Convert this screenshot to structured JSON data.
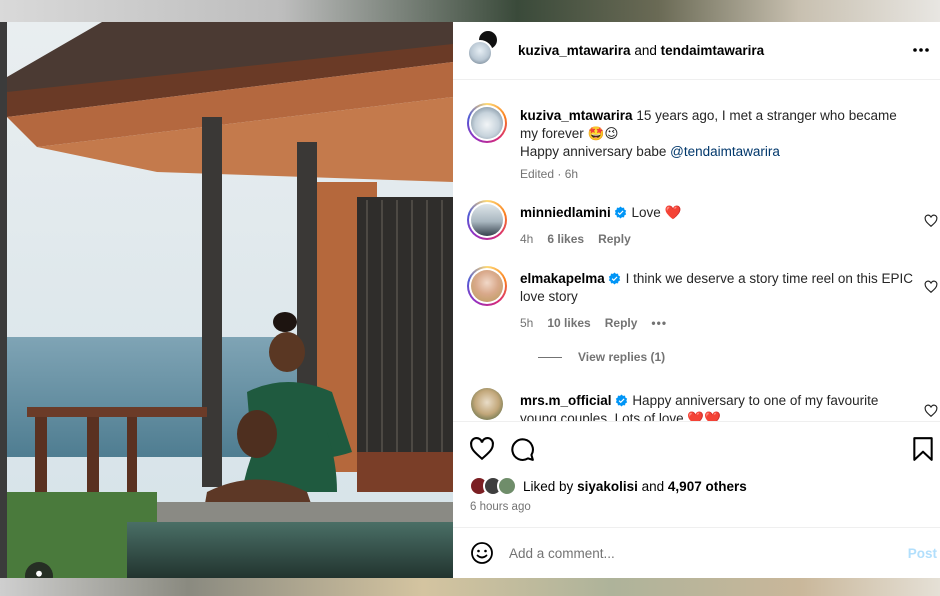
{
  "header": {
    "user1": "kuziva_mtawarira",
    "conjunction": "and",
    "user2": "tendaimtawarira",
    "more_icon": "more-horizontal-icon"
  },
  "caption": {
    "user": "kuziva_mtawarira",
    "text_line1": "15 years ago, I met a stranger who became my forever 🤩😉",
    "text_line2": "Happy anniversary babe",
    "mention": "@tendaimtawarira",
    "edited": "Edited · 6h"
  },
  "comments": [
    {
      "user": "minniedlamini",
      "verified": true,
      "text": "Love",
      "emoji": "❤️",
      "time": "4h",
      "likes": "6 likes",
      "reply": "Reply"
    },
    {
      "user": "elmakapelma",
      "verified": true,
      "text": "I think we deserve a story time reel on this EPIC love story",
      "time": "5h",
      "likes": "10 likes",
      "reply": "Reply",
      "more": "•••",
      "view_replies": "View replies (1)"
    },
    {
      "user": "mrs.m_official",
      "verified": true,
      "text": "Happy anniversary to one of my favourite young couples. Lots of love",
      "emoji": "❤️❤️"
    }
  ],
  "actions": {
    "like_icon": "heart-icon",
    "comment_icon": "comment-bubble-icon",
    "save_icon": "bookmark-icon"
  },
  "likes": {
    "prefix": "Liked by",
    "user": "siyakolisi",
    "middle": "and",
    "others": "4,907 others"
  },
  "timestamp": "6 hours ago",
  "add_comment": {
    "placeholder": "Add a comment...",
    "post_label": "Post",
    "emoji_icon": "smiley-icon"
  },
  "colors": {
    "link": "#00376b",
    "muted": "#737373",
    "post_disabled": "#b2dffc",
    "verified": "#0095f6",
    "heart_red": "#ed1c24"
  }
}
